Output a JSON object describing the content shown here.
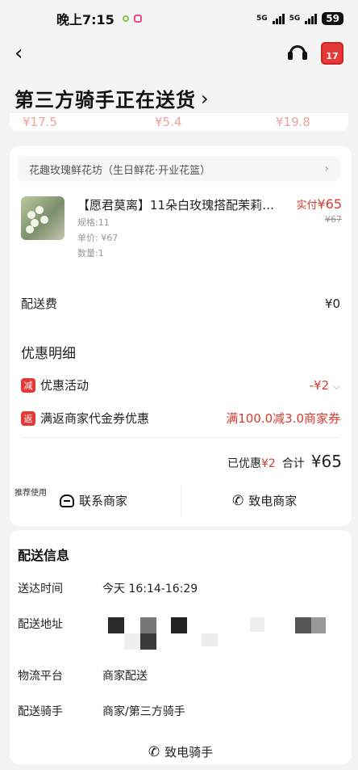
{
  "status_bar": {
    "time": "晚上7:15",
    "network1": "5G",
    "network2": "5G",
    "battery": "59"
  },
  "nav": {
    "back_icon": "back-arrow-icon",
    "service_icon": "headset-icon",
    "calendar_badge": "17"
  },
  "page_title": "第三方骑手正在送货",
  "peek_prices": [
    "¥17.5",
    "¥5.4",
    "¥19.8"
  ],
  "order": {
    "shop_name": "花趣玫瑰鲜花坊（生日鲜花·开业花篮）",
    "product": {
      "name": "【愿君莫离】11朵白玫瑰搭配茉莉…",
      "paid_label": "实付",
      "paid_price": "¥65",
      "original_price": "¥67",
      "spec": "规格:11",
      "unit_price": "单价: ¥67",
      "quantity": "数量:1"
    },
    "delivery_fee_label": "配送费",
    "delivery_fee": "¥0",
    "discount_title": "优惠明细",
    "discounts": [
      {
        "badge": "减",
        "label": "优惠活动",
        "value": "-¥2"
      },
      {
        "badge": "返",
        "label": "满返商家代金券优惠",
        "value": "满100.0减3.0商家券"
      }
    ],
    "saved_label": "已优惠",
    "saved_value": "¥2",
    "total_label": "合计",
    "total_value": "¥65",
    "recommend_label": "推荐使用",
    "contact_merchant": "联系商家",
    "call_merchant": "致电商家"
  },
  "delivery": {
    "title": "配送信息",
    "rows": [
      {
        "label": "送达时间",
        "value": "今天 16:14-16:29"
      },
      {
        "label": "配送地址",
        "value": ""
      },
      {
        "label": "物流平台",
        "value": "商家配送"
      },
      {
        "label": "配送骑手",
        "value": "商家/第三方骑手"
      }
    ],
    "call_rider": "致电骑手"
  },
  "colors": {
    "accent_red": "#d63b2f",
    "badge_red": "#e53935",
    "background": "#f4f4f4"
  }
}
